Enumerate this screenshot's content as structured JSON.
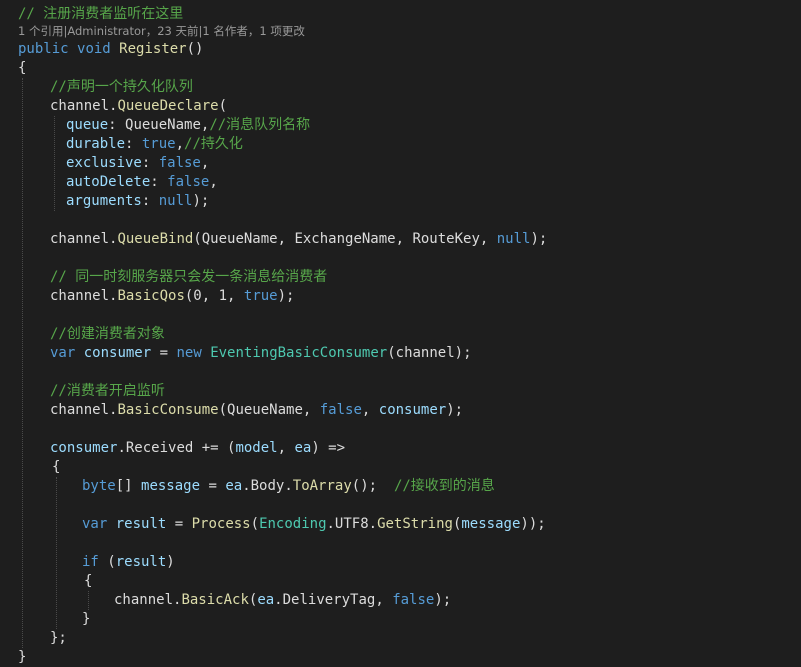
{
  "code": {
    "codelens": "1 个引用|Administrator，23 天前|1 名作者，1 项更改",
    "lines": [
      [
        [
          "c-comment",
          "// 注册消费者监听在这里"
        ]
      ],
      [
        [
          "c-keyword",
          "public"
        ],
        [
          "c-plain",
          " "
        ],
        [
          "c-keyword",
          "void"
        ],
        [
          "c-plain",
          " "
        ],
        [
          "c-method",
          "Register"
        ],
        [
          "c-plain",
          "()"
        ]
      ],
      [
        [
          "c-plain",
          "{"
        ]
      ],
      [
        [
          "c-comment",
          "//声明一个持久化队列"
        ]
      ],
      [
        [
          "c-plain",
          "channel."
        ],
        [
          "c-method",
          "QueueDeclare"
        ],
        [
          "c-plain",
          "("
        ]
      ],
      [
        [
          "c-param",
          "queue"
        ],
        [
          "c-plain",
          ": QueueName,"
        ],
        [
          "c-comment",
          "//消息队列名称"
        ]
      ],
      [
        [
          "c-param",
          "durable"
        ],
        [
          "c-plain",
          ": "
        ],
        [
          "c-keyword",
          "true"
        ],
        [
          "c-plain",
          ","
        ],
        [
          "c-comment",
          "//持久化"
        ]
      ],
      [
        [
          "c-param",
          "exclusive"
        ],
        [
          "c-plain",
          ": "
        ],
        [
          "c-keyword",
          "false"
        ],
        [
          "c-plain",
          ","
        ]
      ],
      [
        [
          "c-param",
          "autoDelete"
        ],
        [
          "c-plain",
          ": "
        ],
        [
          "c-keyword",
          "false"
        ],
        [
          "c-plain",
          ","
        ]
      ],
      [
        [
          "c-param",
          "arguments"
        ],
        [
          "c-plain",
          ": "
        ],
        [
          "c-keyword",
          "null"
        ],
        [
          "c-plain",
          ");"
        ]
      ],
      [
        [
          "c-plain",
          "channel."
        ],
        [
          "c-method",
          "QueueBind"
        ],
        [
          "c-plain",
          "(QueueName, ExchangeName, RouteKey, "
        ],
        [
          "c-keyword",
          "null"
        ],
        [
          "c-plain",
          ");"
        ]
      ],
      [
        [
          "c-comment",
          "// 同一时刻服务器只会发一条消息给消费者"
        ]
      ],
      [
        [
          "c-plain",
          "channel."
        ],
        [
          "c-method",
          "BasicQos"
        ],
        [
          "c-plain",
          "(0, 1, "
        ],
        [
          "c-keyword",
          "true"
        ],
        [
          "c-plain",
          ");"
        ]
      ],
      [
        [
          "c-comment",
          "//创建消费者对象"
        ]
      ],
      [
        [
          "c-keyword",
          "var"
        ],
        [
          "c-plain",
          " "
        ],
        [
          "c-param",
          "consumer"
        ],
        [
          "c-plain",
          " = "
        ],
        [
          "c-keyword",
          "new"
        ],
        [
          "c-plain",
          " "
        ],
        [
          "c-type",
          "EventingBasicConsumer"
        ],
        [
          "c-plain",
          "(channel);"
        ]
      ],
      [
        [
          "c-comment",
          "//消费者开启监听"
        ]
      ],
      [
        [
          "c-plain",
          "channel."
        ],
        [
          "c-method",
          "BasicConsume"
        ],
        [
          "c-plain",
          "(QueueName, "
        ],
        [
          "c-keyword",
          "false"
        ],
        [
          "c-plain",
          ", "
        ],
        [
          "c-param",
          "consumer"
        ],
        [
          "c-plain",
          ");"
        ]
      ],
      [
        [
          "c-param",
          "consumer"
        ],
        [
          "c-plain",
          ".Received += ("
        ],
        [
          "c-param",
          "model"
        ],
        [
          "c-plain",
          ", "
        ],
        [
          "c-param",
          "ea"
        ],
        [
          "c-plain",
          ") =>"
        ]
      ],
      [
        [
          "c-plain",
          "{"
        ]
      ],
      [
        [
          "c-keyword",
          "byte"
        ],
        [
          "c-plain",
          "[] "
        ],
        [
          "c-param",
          "message"
        ],
        [
          "c-plain",
          " = "
        ],
        [
          "c-param",
          "ea"
        ],
        [
          "c-plain",
          ".Body."
        ],
        [
          "c-method",
          "ToArray"
        ],
        [
          "c-plain",
          "();  "
        ],
        [
          "c-comment",
          "//接收到的消息"
        ]
      ],
      [
        [
          "c-keyword",
          "var"
        ],
        [
          "c-plain",
          " "
        ],
        [
          "c-param",
          "result"
        ],
        [
          "c-plain",
          " = "
        ],
        [
          "c-method",
          "Process"
        ],
        [
          "c-plain",
          "("
        ],
        [
          "c-type",
          "Encoding"
        ],
        [
          "c-plain",
          ".UTF8."
        ],
        [
          "c-method",
          "GetString"
        ],
        [
          "c-plain",
          "("
        ],
        [
          "c-param",
          "message"
        ],
        [
          "c-plain",
          "));"
        ]
      ],
      [
        [
          "c-keyword",
          "if"
        ],
        [
          "c-plain",
          " ("
        ],
        [
          "c-param",
          "result"
        ],
        [
          "c-plain",
          ")"
        ]
      ],
      [
        [
          "c-plain",
          "{"
        ]
      ],
      [
        [
          "c-plain",
          "channel."
        ],
        [
          "c-method",
          "BasicAck"
        ],
        [
          "c-plain",
          "("
        ],
        [
          "c-param",
          "ea"
        ],
        [
          "c-plain",
          ".DeliveryTag, "
        ],
        [
          "c-keyword",
          "false"
        ],
        [
          "c-plain",
          ");"
        ]
      ],
      [
        [
          "c-plain",
          "}"
        ]
      ],
      [
        [
          "c-plain",
          "};"
        ]
      ],
      [
        [
          "c-plain",
          "}"
        ]
      ]
    ]
  }
}
